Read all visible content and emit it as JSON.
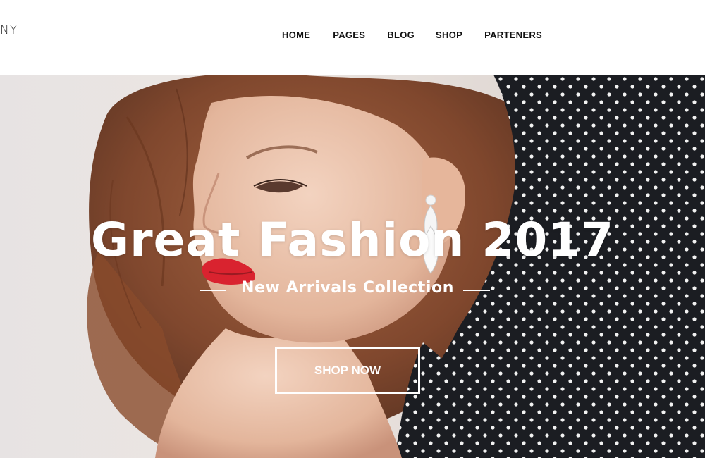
{
  "header": {
    "logo_text": "NY",
    "nav": [
      {
        "label": "HOME"
      },
      {
        "label": "PAGES"
      },
      {
        "label": "BLOG"
      },
      {
        "label": "SHOP"
      },
      {
        "label": "PARTENERS"
      }
    ]
  },
  "hero": {
    "title": "Great Fashion 2017",
    "subtitle": "New Arrivals Collection",
    "cta_label": "SHOP NOW",
    "photo": "fashion-model-photo",
    "colors": {
      "background": "#e9e5e3",
      "dress": "#1b1d22",
      "dots": "#ffffff",
      "lips": "#d9232f",
      "hair": "#8a4b2c",
      "skin": "#e8bfa8"
    }
  }
}
